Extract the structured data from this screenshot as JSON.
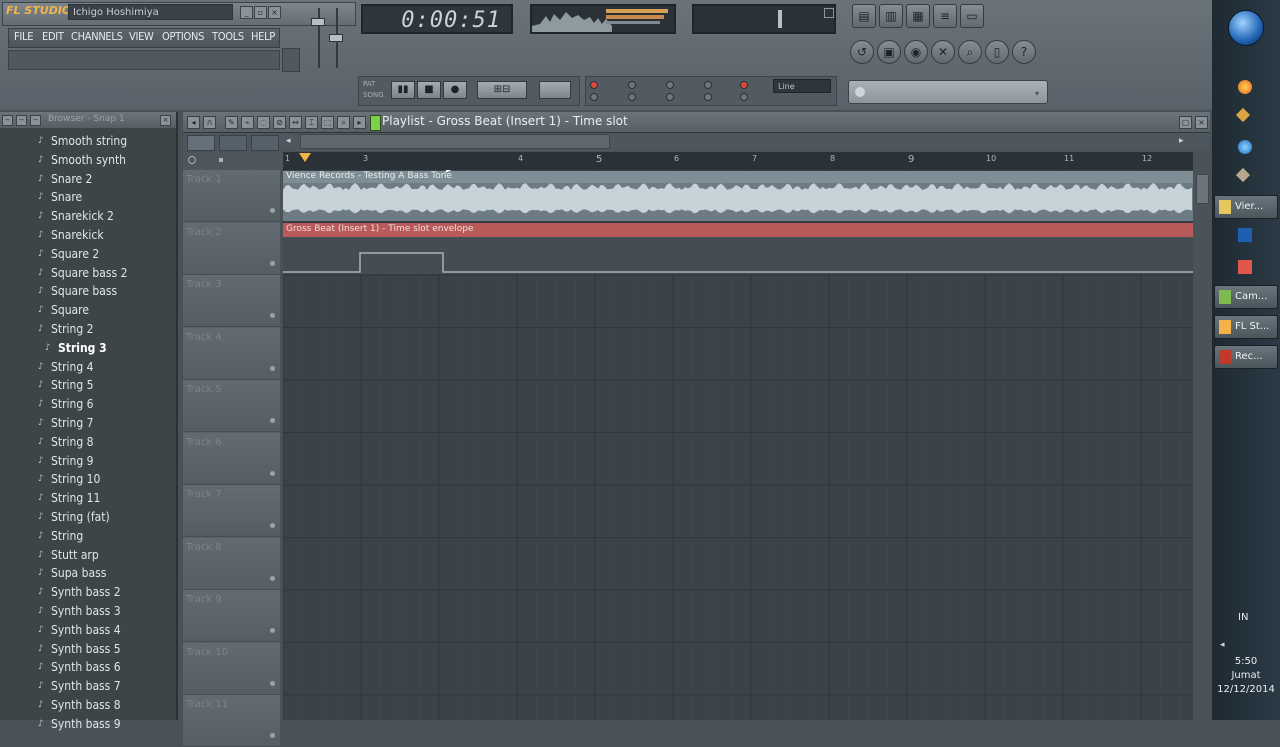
{
  "app": {
    "logo": "FL STUDIO",
    "project_name": "Ichigo Hoshimiya",
    "menu": [
      "FILE",
      "EDIT",
      "CHANNELS",
      "VIEW",
      "OPTIONS",
      "TOOLS",
      "HELP"
    ]
  },
  "transport": {
    "time": "0:00:51",
    "snap": "Line",
    "pat_label": "PAT",
    "song_label": "SONG"
  },
  "browser": {
    "title": "Browser - Snap 1",
    "items": [
      "Smooth string",
      "Smooth synth",
      "Snare 2",
      "Snare",
      "Snarekick 2",
      "Snarekick",
      "Square 2",
      "Square bass 2",
      "Square bass",
      "Square",
      "String 2",
      "String 3",
      "String 4",
      "String 5",
      "String 6",
      "String 7",
      "String 8",
      "String 9",
      "String 10",
      "String 11",
      "String (fat)",
      "String",
      "Stutt arp",
      "Supa bass",
      "Synth bass 2",
      "Synth bass 3",
      "Synth bass 4",
      "Synth bass 5",
      "Synth bass 6",
      "Synth bass 7",
      "Synth bass 8",
      "Synth bass 9"
    ],
    "selected_index": 11
  },
  "playlist": {
    "title": "Playlist - Gross Beat (Insert 1) - Time slot",
    "ruler_numbers": [
      "1",
      "3",
      "4",
      "5",
      "6",
      "7",
      "8",
      "9",
      "10",
      "11",
      "12"
    ],
    "clip_audio_label": "Vience Records - Testing A Bass Tone",
    "clip_envelope_label": "Gross Beat (Insert 1) - Time slot envelope",
    "tracks": [
      "Track 1",
      "Track 2",
      "Track 3",
      "Track 4",
      "Track 5",
      "Track 6",
      "Track 7",
      "Track 8",
      "Track 9",
      "Track 10",
      "Track 11"
    ]
  },
  "taskbar": {
    "buttons": [
      "Vier...",
      "Cam...",
      "FL St...",
      "Rec..."
    ],
    "lang": "IN",
    "clock_time": "5:50",
    "clock_day": "Jumat",
    "clock_date": "12/12/2014"
  },
  "colors": {
    "accent_orange": "#f3b34a",
    "envelope_red": "#b85a5a",
    "waveform": "#c7d3d9"
  }
}
